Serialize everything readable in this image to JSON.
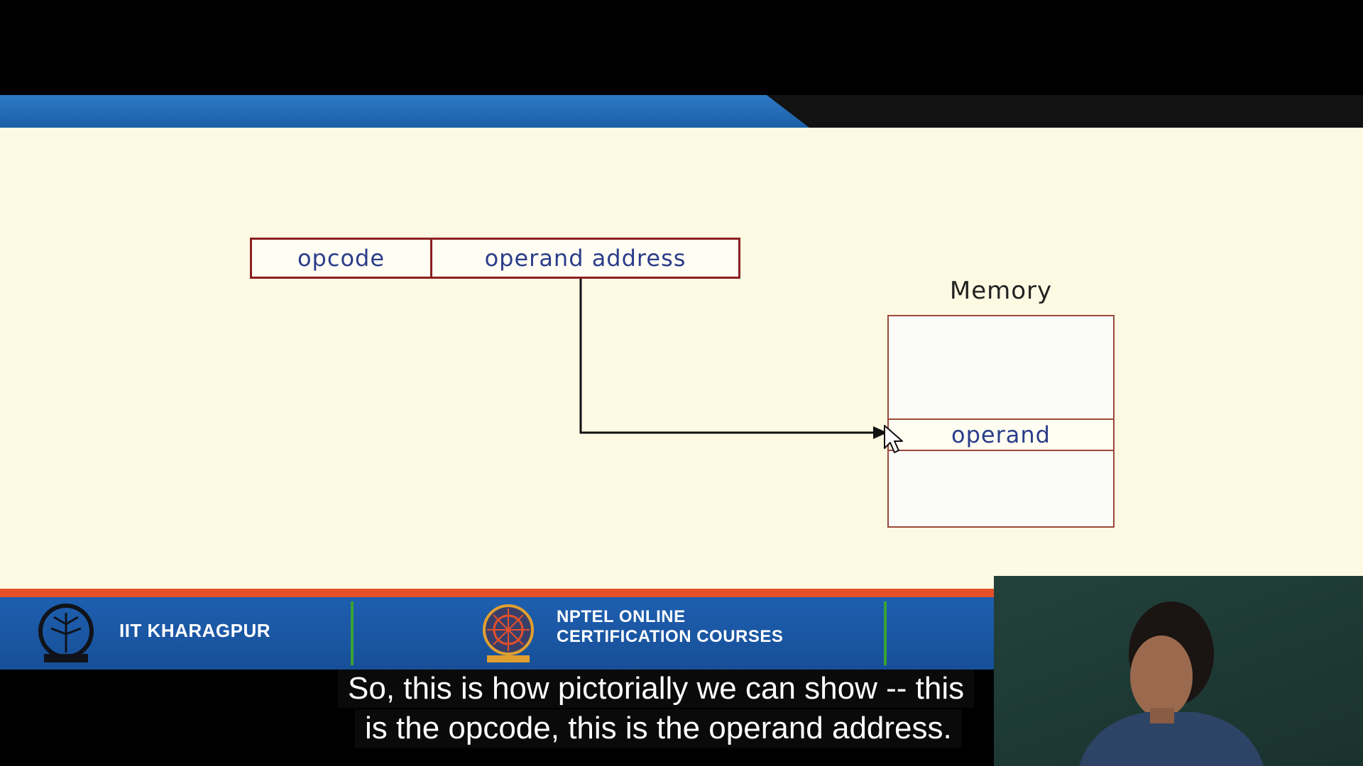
{
  "slide": {
    "instruction_fields": [
      "opcode",
      "operand address"
    ],
    "memory": {
      "label": "Memory",
      "operand_label": "operand"
    }
  },
  "footer": {
    "institute": "IIT KHARAGPUR",
    "program_line1": "NPTEL ONLINE",
    "program_line2": "CERTIFICATION COURSES"
  },
  "caption": {
    "line1": "So, this is how pictorially we can show -- this",
    "line2": "is the opcode, this is the operand address."
  },
  "colors": {
    "slide_background": "#fdf9e3",
    "box_border": "#8b1f1f",
    "text_blue": "#2b3c8a",
    "header_blue": "#1a5fa8",
    "footer_blue": "#174f97",
    "footer_orange": "#e5502a",
    "footer_divider_green": "#3aa335"
  },
  "icons": [
    "iit-kharagpur-logo-icon",
    "nptel-logo-icon",
    "mouse-cursor-icon"
  ]
}
